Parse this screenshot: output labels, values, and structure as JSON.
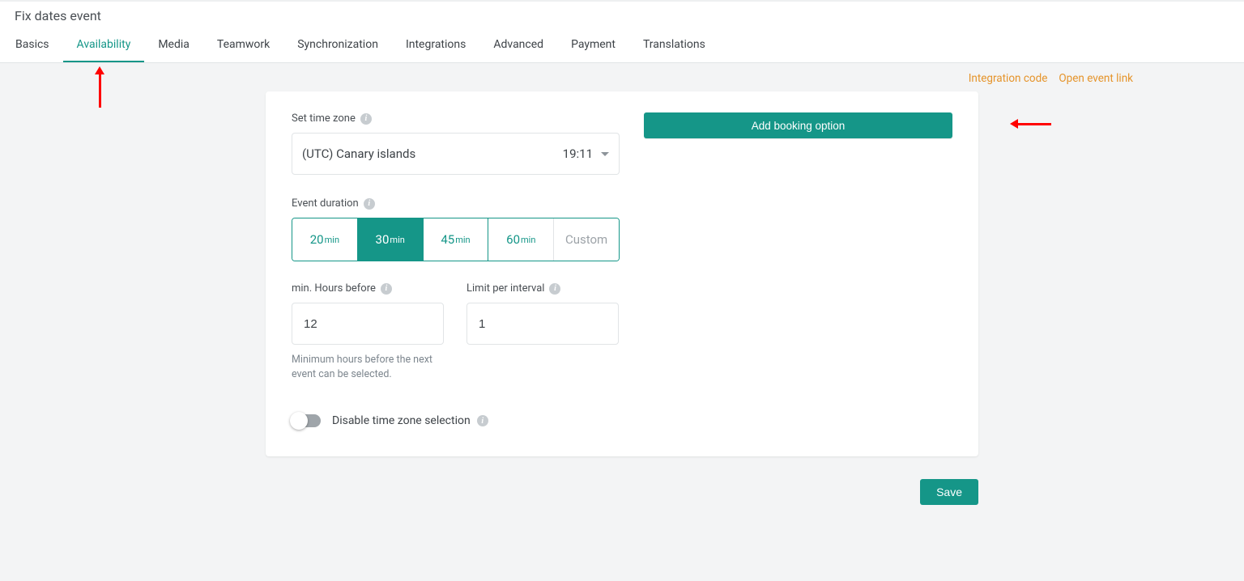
{
  "header": {
    "title": "Fix dates event"
  },
  "tabs": {
    "items": [
      "Basics",
      "Availability",
      "Media",
      "Teamwork",
      "Synchronization",
      "Integrations",
      "Advanced",
      "Payment",
      "Translations"
    ],
    "active_index": 1
  },
  "links": {
    "integration_code": "Integration code",
    "open_event_link": "Open event link"
  },
  "form": {
    "timezone_label": "Set time zone",
    "timezone_value": "(UTC) Canary islands",
    "timezone_clock": "19:11",
    "duration_label": "Event duration",
    "durations": [
      {
        "num": "20",
        "unit": "min",
        "selected": false
      },
      {
        "num": "30",
        "unit": "min",
        "selected": true
      },
      {
        "num": "45",
        "unit": "min",
        "selected": false
      },
      {
        "num": "60",
        "unit": "min",
        "selected": false
      }
    ],
    "duration_custom": "Custom",
    "min_hours_label": "min. Hours before",
    "min_hours_value": "12",
    "min_hours_help": "Minimum hours before the next event can be selected.",
    "limit_label": "Limit per interval",
    "limit_value": "1",
    "disable_tz_label": "Disable time zone selection"
  },
  "actions": {
    "add_booking": "Add booking option",
    "save": "Save"
  }
}
